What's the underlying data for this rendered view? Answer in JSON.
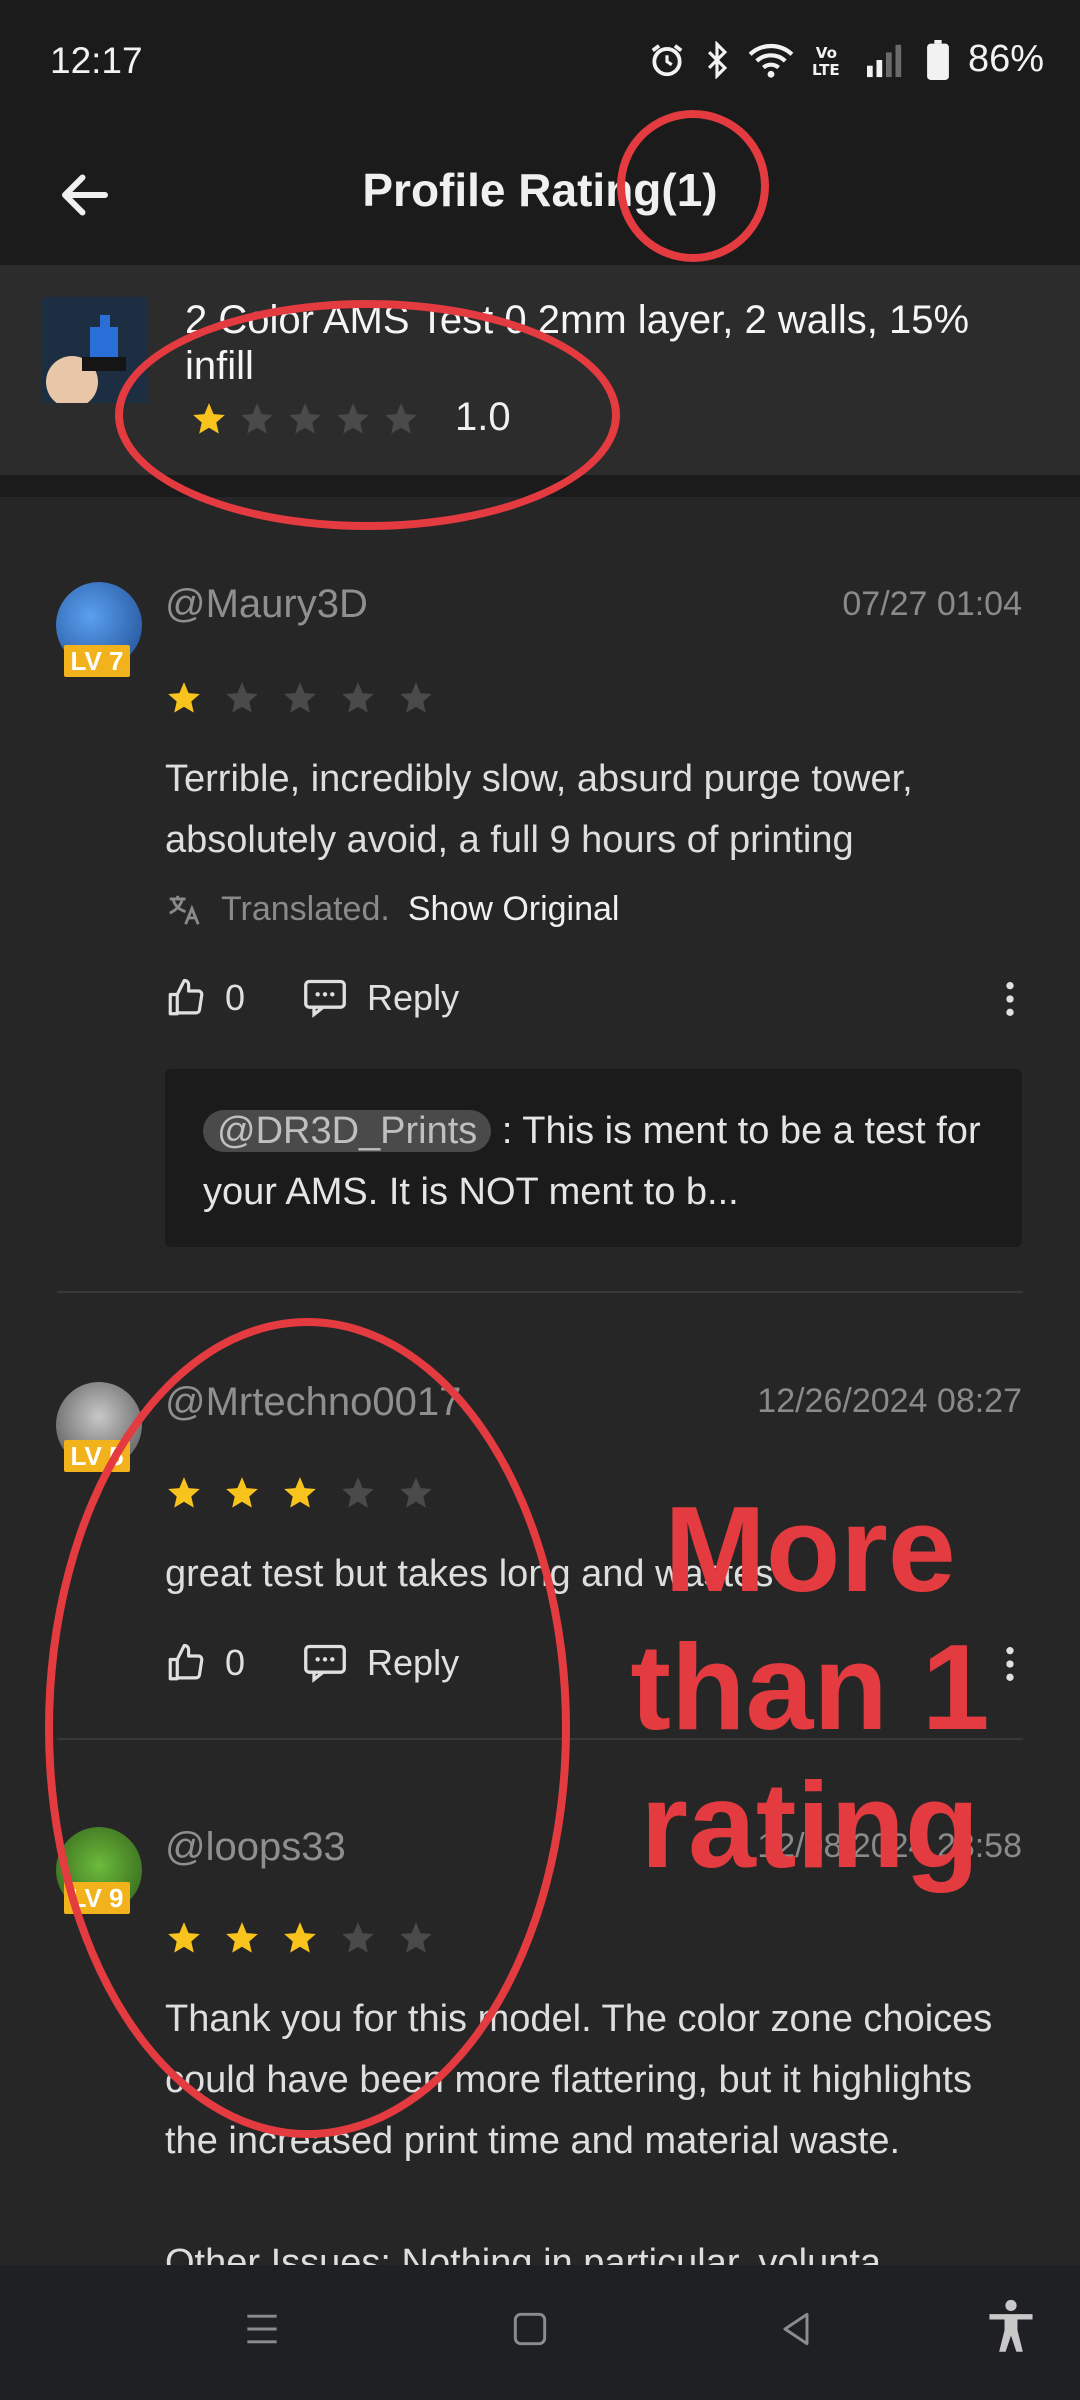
{
  "status_bar": {
    "time": "12:17",
    "battery": "86%"
  },
  "app_bar": {
    "title": "Profile Rating(1)",
    "back_icon": "arrow-left-icon"
  },
  "model": {
    "title": "2 Color AMS Test 0.2mm layer, 2 walls, 15% infill",
    "rating": 1,
    "score_text": "1.0"
  },
  "reviews": [
    {
      "username": "@Maury3D",
      "level": "LV 7",
      "date": "07/27 01:04",
      "rating": 1,
      "text": "Terrible, incredibly slow, absurd purge tower, absolutely avoid, a full 9 hours of printing",
      "translated_label": "Translated.",
      "show_original_label": "Show Original",
      "likes": "0",
      "reply_label": "Reply",
      "reply_preview": {
        "mention": "@DR3D_Prints",
        "text": " : This is ment to be a test for your AMS. It is NOT ment to b..."
      }
    },
    {
      "username": "@Mrtechno0017",
      "level": "LV 5",
      "date": "12/26/2024 08:27",
      "rating": 3,
      "text": "great test but takes long and wastes",
      "likes": "0",
      "reply_label": "Reply"
    },
    {
      "username": "@loops33",
      "level": "LV 9",
      "date": "12/08/2024 23:58",
      "rating": 3,
      "text": "Thank you for this model. The color zone choices could have been more flattering, but it highlights the increased print time and material waste.",
      "text_extra": "Other Issues: Nothing in particular, volunta"
    }
  ],
  "annotation": {
    "text": "More than 1 rating",
    "color": "#e33b3f"
  },
  "colors": {
    "star_filled": "#f8c31c",
    "star_empty": "#4a4a4a",
    "background": "#262626"
  }
}
